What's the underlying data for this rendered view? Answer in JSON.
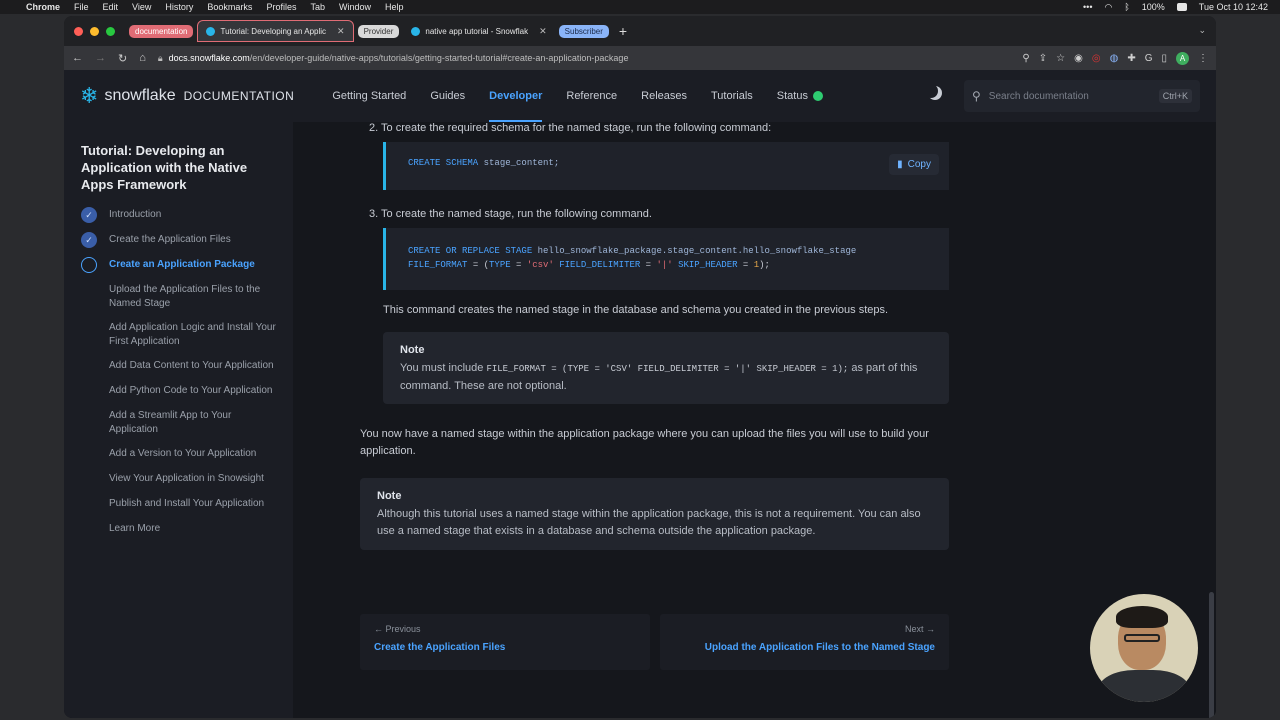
{
  "menubar": {
    "app": "Chrome",
    "items": [
      "File",
      "Edit",
      "View",
      "History",
      "Bookmarks",
      "Profiles",
      "Tab",
      "Window",
      "Help"
    ],
    "battery": "100%",
    "datetime": "Tue Oct 10  12:42"
  },
  "tabs": [
    {
      "kind": "group",
      "label": "documentation",
      "color": "#e06c75"
    },
    {
      "kind": "tab",
      "label": "Tutorial: Developing an Applic",
      "active": true
    },
    {
      "kind": "group",
      "label": "Provider",
      "color": "#d9d9d9"
    },
    {
      "kind": "tab",
      "label": "native app tutorial - Snowflak",
      "active": false
    },
    {
      "kind": "group",
      "label": "Subscriber",
      "color": "#8ab4f8"
    }
  ],
  "address": {
    "domain": "docs.snowflake.com",
    "path": "/en/developer-guide/native-apps/tutorials/getting-started-tutorial#create-an-application-package"
  },
  "header": {
    "brand": "snowflake",
    "brand_suffix": "DOCUMENTATION",
    "nav": [
      "Getting Started",
      "Guides",
      "Developer",
      "Reference",
      "Releases",
      "Tutorials",
      "Status"
    ],
    "active_nav": "Developer",
    "search_placeholder": "Search documentation",
    "search_shortcut": "Ctrl+K"
  },
  "sidebar": {
    "title": "Tutorial: Developing an Application with the Native Apps Framework",
    "items": [
      {
        "label": "Introduction",
        "state": "done"
      },
      {
        "label": "Create the Application Files",
        "state": "done"
      },
      {
        "label": "Create an Application Package",
        "state": "current"
      },
      {
        "label": "Upload the Application Files to the Named Stage",
        "state": "todo"
      },
      {
        "label": "Add Application Logic and Install Your First Application",
        "state": "todo"
      },
      {
        "label": "Add Data Content to Your Application",
        "state": "todo"
      },
      {
        "label": "Add Python Code to Your Application",
        "state": "todo"
      },
      {
        "label": "Add a Streamlit App to Your Application",
        "state": "todo"
      },
      {
        "label": "Add a Version to Your Application",
        "state": "todo"
      },
      {
        "label": "View Your Application in Snowsight",
        "state": "todo"
      },
      {
        "label": "Publish and Install Your Application",
        "state": "todo"
      },
      {
        "label": "Learn More",
        "state": "todo"
      }
    ]
  },
  "main": {
    "step2": "2.  To create the required schema for the named stage, run the following command:",
    "code1": {
      "kw": "CREATE SCHEMA",
      "rest": " stage_content;"
    },
    "copy_label": "Copy",
    "step3": "3.  To create the named stage, run the following command.",
    "code2": {
      "l1_kw": "CREATE OR REPLACE STAGE",
      "l1_rest": " hello_snowflake_package.stage_content.hello_snowflake_stage",
      "l2_a": "  FILE_FORMAT",
      "l2_b": " = (",
      "l2_c": "TYPE",
      "l2_d": " = ",
      "l2_e": "'csv'",
      "l2_f": " FIELD_DELIMITER",
      "l2_g": " = ",
      "l2_h": "'|'",
      "l2_i": " SKIP_HEADER",
      "l2_j": " = ",
      "l2_k": "1",
      "l2_l": ");"
    },
    "command_desc": "This command creates the named stage in the database and schema you created in the previous steps.",
    "note1": {
      "title": "Note",
      "pre": "You must include ",
      "code": "FILE_FORMAT = (TYPE = 'CSV' FIELD_DELIMITER = '|' SKIP_HEADER = 1);",
      "post": " as part of this command. These are not optional."
    },
    "summary": "You now have a named stage within the application package where you can upload the files you will use to build your application.",
    "note2": {
      "title": "Note",
      "body": "Although this tutorial uses a named stage within the application package, this is not a requirement. You can also use a named stage that exists in a database and schema outside the application package."
    },
    "prev": {
      "label": "Previous",
      "link": "Create the Application Files"
    },
    "next": {
      "label": "Next",
      "link": "Upload the Application Files to the Named Stage"
    }
  }
}
